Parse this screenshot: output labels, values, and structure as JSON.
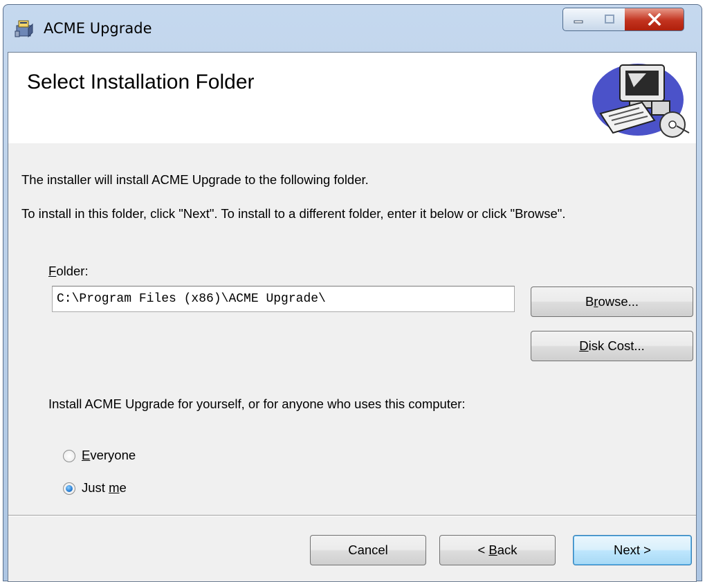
{
  "window": {
    "title": "ACME Upgrade"
  },
  "banner": {
    "title": "Select Installation Folder"
  },
  "body": {
    "intro_line": "The installer will install ACME Upgrade to the following folder.",
    "instruction_line": "To install in this folder, click \"Next\". To install to a different folder, enter it below or click \"Browse\"."
  },
  "folder": {
    "label_first": "F",
    "label_rest": "older:",
    "value": "C:\\Program Files (x86)\\ACME Upgrade\\"
  },
  "buttons": {
    "browse_pre": "B",
    "browse_u": "r",
    "browse_post": "owse...",
    "diskcost_u": "D",
    "diskcost_post": "isk Cost...",
    "cancel": "Cancel",
    "back_pre": "< ",
    "back_u": "B",
    "back_post": "ack",
    "next": "Next >"
  },
  "install_for": {
    "question": "Install ACME Upgrade for yourself, or for anyone who uses this computer:",
    "options": [
      {
        "u": "E",
        "rest": "veryone",
        "selected": false
      },
      {
        "pre": "Just ",
        "u": "m",
        "rest": "e",
        "selected": true
      }
    ]
  },
  "colors": {
    "close_button": "#c2331f",
    "radio_checked": "#2a7fd4",
    "default_button_border": "#3c7fb1"
  },
  "icons": {
    "app": "installer-box-icon",
    "banner": "computer-cd-icon"
  }
}
